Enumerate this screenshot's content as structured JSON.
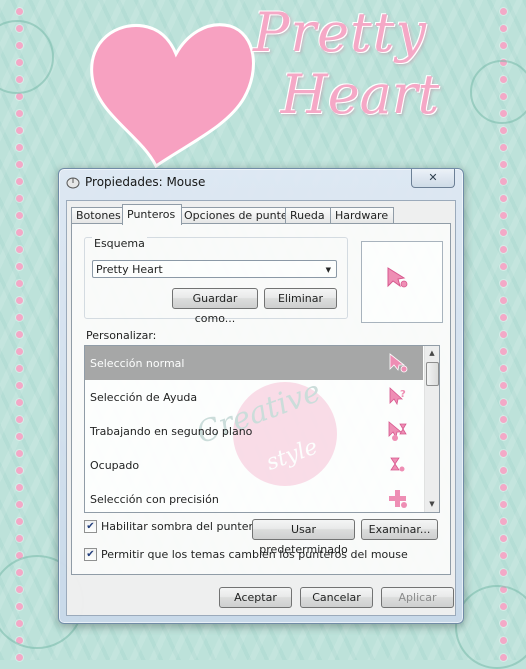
{
  "colors": {
    "background_teal": "#bde2da",
    "heart_pink": "#f7a1c1",
    "dot_pink": "#f3a9c7",
    "cursor_pink": "#f08cb3",
    "selected_row": "#a6a6a6"
  },
  "background": {
    "logo_line1": "Pretty",
    "logo_line2": "Heart",
    "watermark_line1": "Creative",
    "watermark_line2": "style"
  },
  "window": {
    "title": "Propiedades: Mouse",
    "close_label": "✕",
    "tabs": [
      {
        "label": "Botones",
        "active": false
      },
      {
        "label": "Punteros",
        "active": true
      },
      {
        "label": "Opciones de puntero",
        "active": false
      },
      {
        "label": "Rueda",
        "active": false
      },
      {
        "label": "Hardware",
        "active": false
      }
    ],
    "scheme": {
      "group_label": "Esquema",
      "selected": "Pretty Heart",
      "save_label": "Guardar como...",
      "delete_label": "Eliminar"
    },
    "customize": {
      "label": "Personalizar:",
      "items": [
        {
          "label": "Selección normal",
          "icon": "arrow-pointer-icon",
          "selected": true
        },
        {
          "label": "Selección de Ayuda",
          "icon": "help-select-icon",
          "selected": false
        },
        {
          "label": "Trabajando en segundo plano",
          "icon": "working-background-icon",
          "selected": false
        },
        {
          "label": "Ocupado",
          "icon": "busy-hourglass-icon",
          "selected": false
        },
        {
          "label": "Selección con precisión",
          "icon": "precision-cross-icon",
          "selected": false
        }
      ]
    },
    "shadow_checkbox": {
      "label": "Habilitar sombra del puntero",
      "checked": true
    },
    "default_label": "Usar predeterminado",
    "browse_label": "Examinar...",
    "themes_checkbox": {
      "label": "Permitir que los temas cambien los punteros del mouse",
      "checked": true
    },
    "footer": {
      "ok_label": "Aceptar",
      "cancel_label": "Cancelar",
      "apply_label": "Aplicar"
    }
  }
}
